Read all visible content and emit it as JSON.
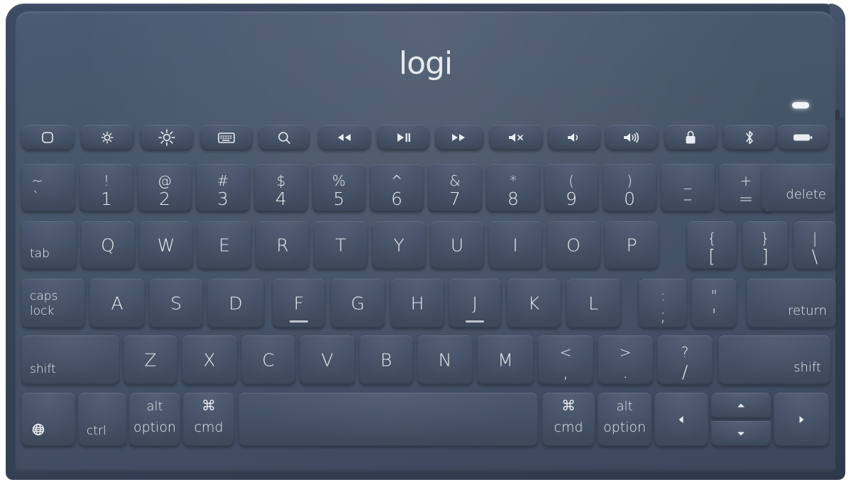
{
  "device": {
    "brand": "logi",
    "product_type": "wireless keyboard",
    "body_color": "#414e63",
    "key_color": "#445166",
    "legend_color": "#e8ebf1",
    "frame_color": "#364256",
    "indicator_led_color": "#f2f4f8"
  },
  "function_row": [
    {
      "name": "home",
      "icon": "rounded-square-icon"
    },
    {
      "name": "brightness-down",
      "icon": "brightness-down-icon"
    },
    {
      "name": "brightness-up",
      "icon": "brightness-up-icon"
    },
    {
      "name": "keyboard-backlight",
      "icon": "keyboard-icon"
    },
    {
      "name": "search",
      "icon": "search-icon"
    },
    {
      "name": "previous-track",
      "icon": "rewind-icon"
    },
    {
      "name": "play-pause",
      "icon": "play-pause-icon"
    },
    {
      "name": "next-track",
      "icon": "fast-forward-icon"
    },
    {
      "name": "mute",
      "icon": "mute-icon"
    },
    {
      "name": "volume-down",
      "icon": "volume-down-icon"
    },
    {
      "name": "volume-up",
      "icon": "volume-up-icon"
    },
    {
      "name": "lock",
      "icon": "lock-icon"
    },
    {
      "name": "bluetooth",
      "icon": "bluetooth-icon"
    },
    {
      "name": "battery",
      "icon": "battery-icon"
    }
  ],
  "number_row": [
    {
      "name": "backquote",
      "top": "~",
      "bottom": "`",
      "align": "left"
    },
    {
      "name": "1",
      "top": "!",
      "bottom": "1"
    },
    {
      "name": "2",
      "top": "@",
      "bottom": "2"
    },
    {
      "name": "3",
      "top": "#",
      "bottom": "3"
    },
    {
      "name": "4",
      "top": "$",
      "bottom": "4"
    },
    {
      "name": "5",
      "top": "%",
      "bottom": "5"
    },
    {
      "name": "6",
      "top": "^",
      "bottom": "6"
    },
    {
      "name": "7",
      "top": "&",
      "bottom": "7"
    },
    {
      "name": "8",
      "top": "*",
      "bottom": "8"
    },
    {
      "name": "9",
      "top": "(",
      "bottom": "9"
    },
    {
      "name": "0",
      "top": ")",
      "bottom": "0"
    },
    {
      "name": "minus",
      "top": "_",
      "bottom": "–"
    },
    {
      "name": "equal",
      "top": "+",
      "bottom": "="
    },
    {
      "name": "delete",
      "word": "delete",
      "align": "bottom-right"
    }
  ],
  "tab_row": [
    {
      "name": "tab",
      "word": "tab",
      "align": "bottom-left"
    },
    {
      "name": "q",
      "label": "Q"
    },
    {
      "name": "w",
      "label": "W"
    },
    {
      "name": "e",
      "label": "E"
    },
    {
      "name": "r",
      "label": "R"
    },
    {
      "name": "t",
      "label": "T"
    },
    {
      "name": "y",
      "label": "Y"
    },
    {
      "name": "u",
      "label": "U"
    },
    {
      "name": "i",
      "label": "I"
    },
    {
      "name": "o",
      "label": "O"
    },
    {
      "name": "p",
      "label": "P"
    },
    {
      "name": "bracket-left",
      "top": "{",
      "bottom": "["
    },
    {
      "name": "bracket-right",
      "top": "}",
      "bottom": "]"
    },
    {
      "name": "backslash",
      "top": "|",
      "bottom": "\\"
    }
  ],
  "home_row": [
    {
      "name": "caps-lock",
      "word_line1": "caps",
      "word_line2": "lock",
      "align": "bottom-left"
    },
    {
      "name": "a",
      "label": "A"
    },
    {
      "name": "s",
      "label": "S"
    },
    {
      "name": "d",
      "label": "D"
    },
    {
      "name": "f",
      "label": "F",
      "homing_bar": true
    },
    {
      "name": "g",
      "label": "G"
    },
    {
      "name": "h",
      "label": "H"
    },
    {
      "name": "j",
      "label": "J",
      "homing_bar": true
    },
    {
      "name": "k",
      "label": "K"
    },
    {
      "name": "l",
      "label": "L"
    },
    {
      "name": "semicolon",
      "top": ":",
      "bottom": ";"
    },
    {
      "name": "quote",
      "top": "\"",
      "bottom": "'"
    },
    {
      "name": "return",
      "word": "return",
      "align": "bottom-right"
    }
  ],
  "shift_row": [
    {
      "name": "shift-left",
      "word": "shift",
      "align": "bottom-left"
    },
    {
      "name": "z",
      "label": "Z"
    },
    {
      "name": "x",
      "label": "X"
    },
    {
      "name": "c",
      "label": "C"
    },
    {
      "name": "v",
      "label": "V"
    },
    {
      "name": "b",
      "label": "B"
    },
    {
      "name": "n",
      "label": "N"
    },
    {
      "name": "m",
      "label": "M"
    },
    {
      "name": "comma",
      "top": "<",
      "bottom": ","
    },
    {
      "name": "period",
      "top": ">",
      "bottom": "."
    },
    {
      "name": "slash",
      "top": "?",
      "bottom": "/"
    },
    {
      "name": "shift-right",
      "word": "shift",
      "align": "bottom-right"
    }
  ],
  "bottom_row": [
    {
      "name": "globe",
      "icon": "globe-icon"
    },
    {
      "name": "ctrl",
      "word": "ctrl",
      "align": "bottom-left"
    },
    {
      "name": "alt-option-left",
      "line1": "alt",
      "line2": "option"
    },
    {
      "name": "cmd-left",
      "line1": "⌘",
      "line2": "cmd"
    },
    {
      "name": "space",
      "label": ""
    },
    {
      "name": "cmd-right",
      "line1": "⌘",
      "line2": "cmd"
    },
    {
      "name": "alt-option-right",
      "line1": "alt",
      "line2": "option"
    },
    {
      "name": "arrow-left",
      "icon": "arrow-left-icon"
    },
    {
      "name": "arrow-up",
      "icon": "arrow-up-icon"
    },
    {
      "name": "arrow-down",
      "icon": "arrow-down-icon"
    },
    {
      "name": "arrow-right",
      "icon": "arrow-right-icon"
    }
  ]
}
